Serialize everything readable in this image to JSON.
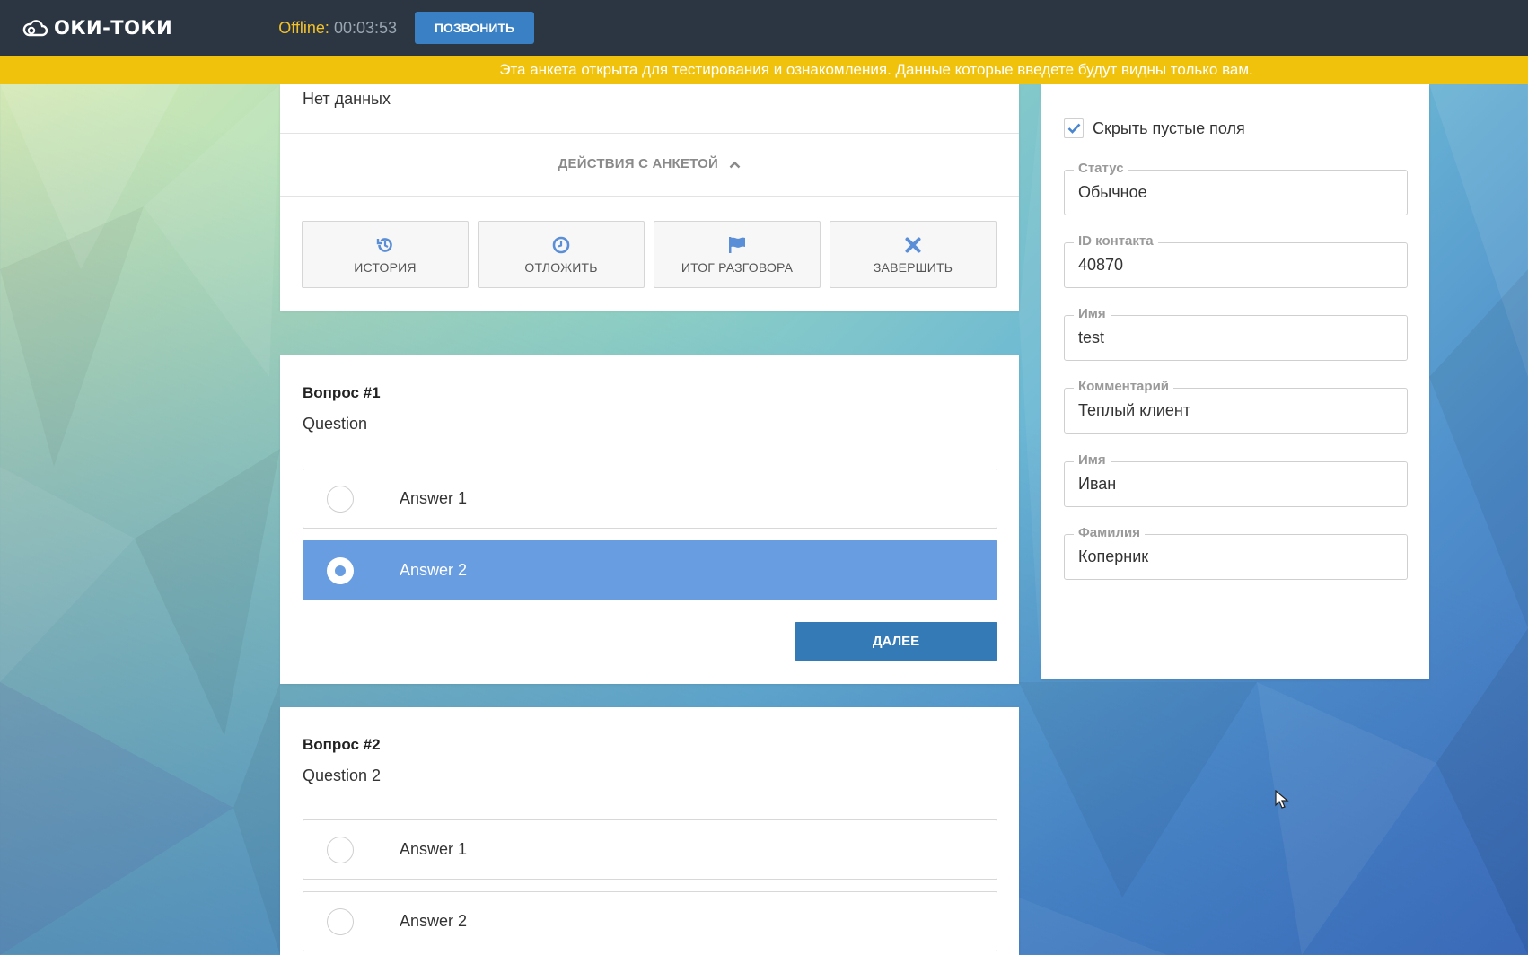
{
  "app": {
    "logo_text": "ОКИ-ТОКИ"
  },
  "header": {
    "status_label": "Offline:",
    "status_time": "00:03:53",
    "call_button": "ПОЗВОНИТЬ"
  },
  "banner": {
    "text": "Эта анкета открыта для тестирования и ознакомления. Данные которые введете будут видны только вам."
  },
  "summary": {
    "no_data": "Нет данных",
    "actions_title": "ДЕЙСТВИЯ С АНКЕТОЙ",
    "actions": [
      {
        "label": "ИСТОРИЯ",
        "icon": "history-icon"
      },
      {
        "label": "ОТЛОЖИТЬ",
        "icon": "clock-icon"
      },
      {
        "label": "ИТОГ РАЗГОВОРА",
        "icon": "flag-icon"
      },
      {
        "label": "ЗАВЕРШИТЬ",
        "icon": "close-icon"
      }
    ]
  },
  "questions": [
    {
      "title": "Вопрос #1",
      "text": "Question",
      "answers": [
        {
          "label": "Answer 1",
          "selected": false
        },
        {
          "label": "Answer 2",
          "selected": true
        }
      ],
      "next_button": "ДАЛЕЕ"
    },
    {
      "title": "Вопрос #2",
      "text": "Question 2",
      "answers": [
        {
          "label": "Answer 1",
          "selected": false
        },
        {
          "label": "Answer 2",
          "selected": false
        }
      ]
    }
  ],
  "contact_panel": {
    "hide_empty_label": "Скрыть пустые поля",
    "hide_empty_checked": true,
    "fields": [
      {
        "label": "Статус",
        "value": "Обычное"
      },
      {
        "label": "ID контакта",
        "value": "40870"
      },
      {
        "label": "Имя",
        "value": "test"
      },
      {
        "label": "Комментарий",
        "value": "Теплый клиент"
      },
      {
        "label": "Имя",
        "value": "Иван"
      },
      {
        "label": "Фамилия",
        "value": "Коперник"
      }
    ]
  },
  "colors": {
    "topbar": "#2b3642",
    "banner": "#f0c20c",
    "accent": "#337ab7",
    "selected_answer": "#699de1",
    "offline": "#f3c12a"
  }
}
